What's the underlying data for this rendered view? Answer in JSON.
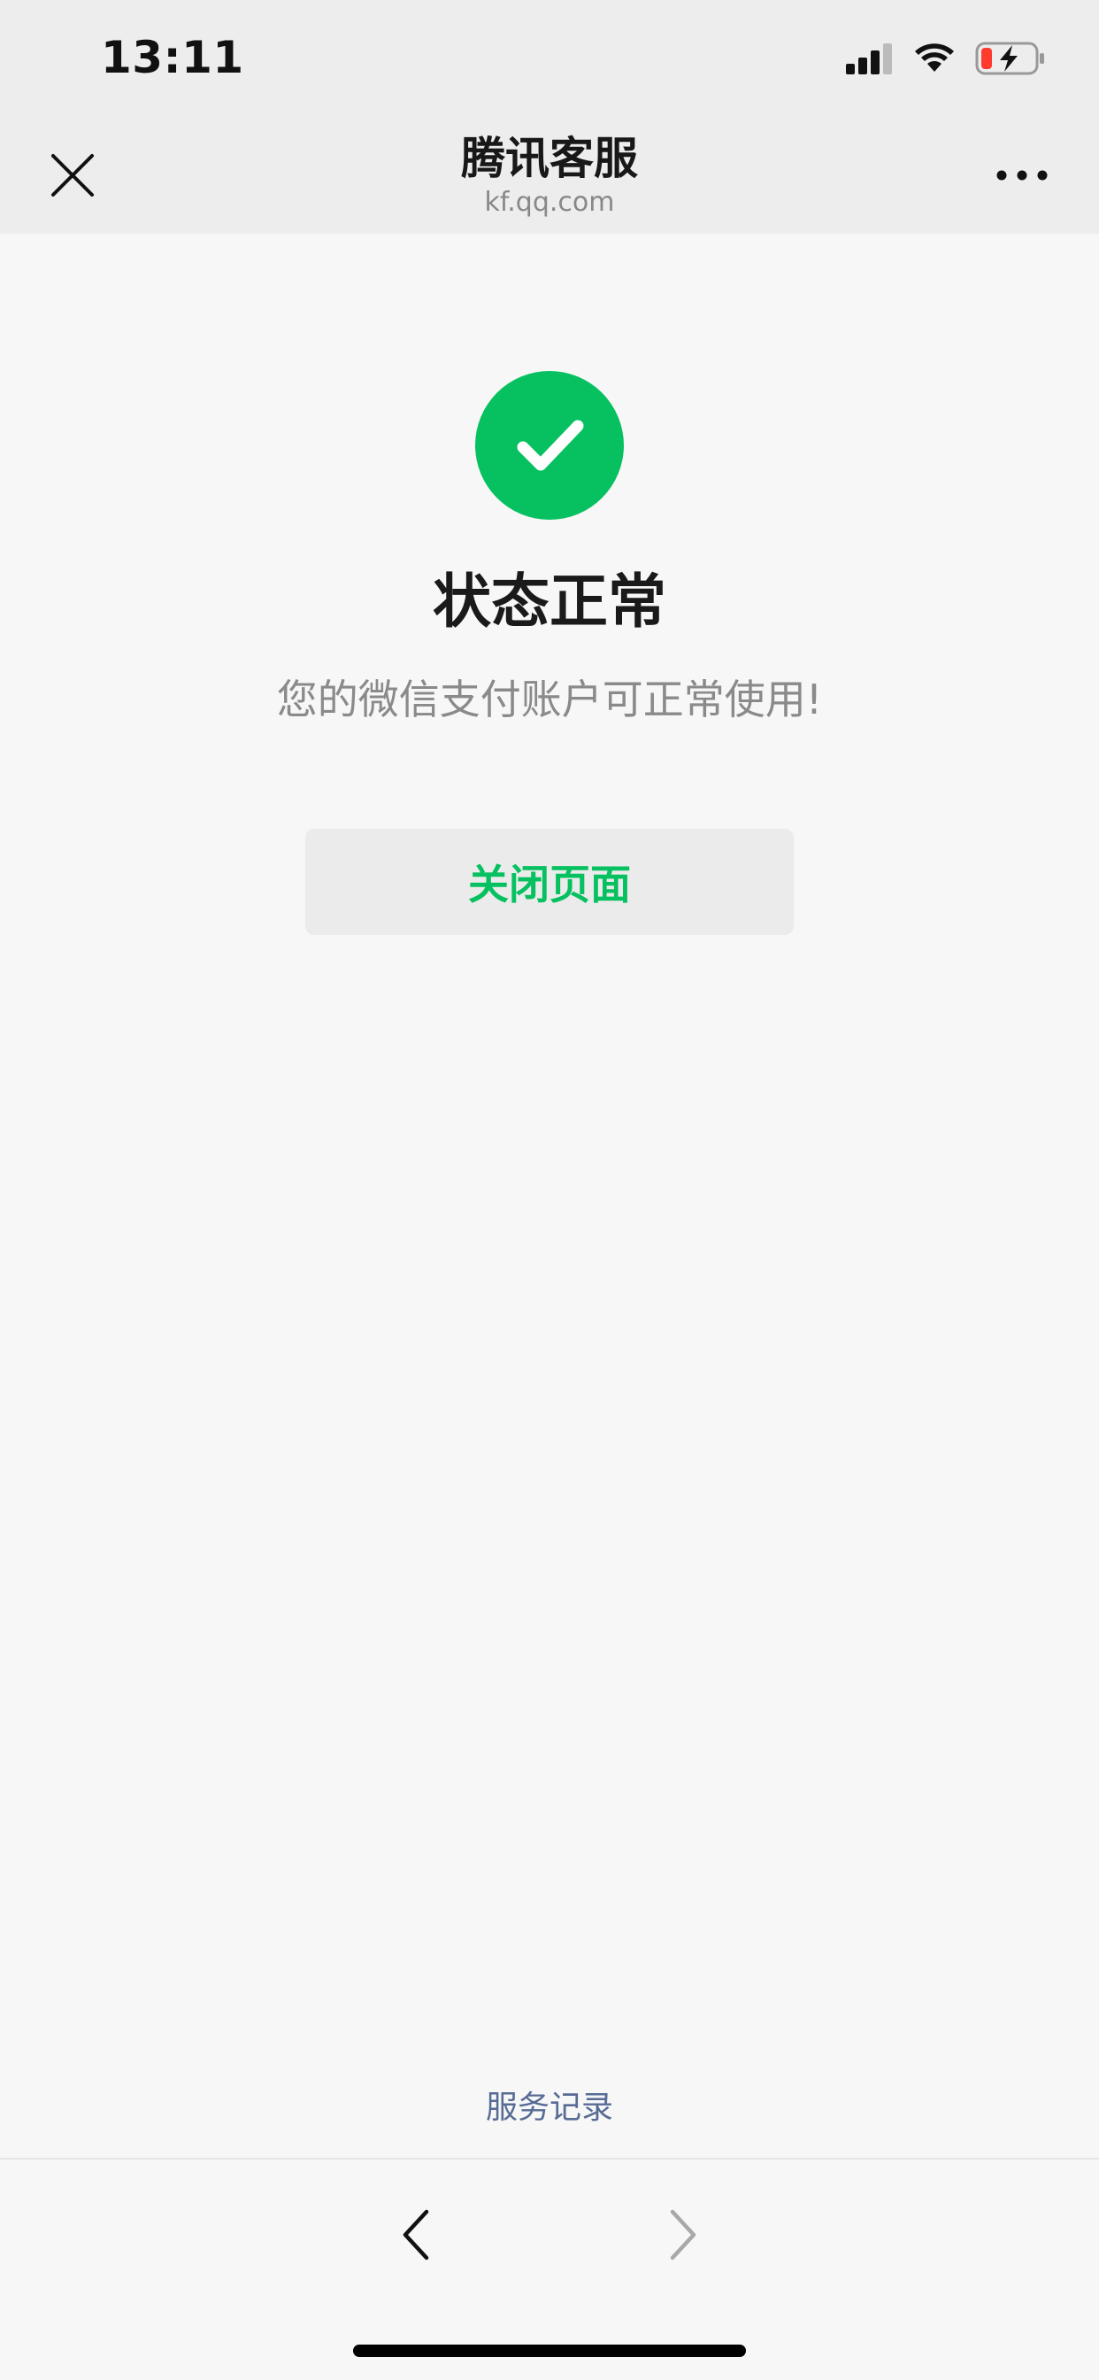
{
  "status_bar": {
    "time": "13:11",
    "signal_icon": "cellular-signal-icon",
    "wifi_icon": "wifi-icon",
    "battery_icon": "battery-charging-icon"
  },
  "nav": {
    "title": "腾讯客服",
    "subtitle": "kf.qq.com",
    "close_icon": "close-icon",
    "more_icon": "more-icon"
  },
  "result": {
    "icon": "success-check-icon",
    "title": "状态正常",
    "description": "您的微信支付账户可正常使用!",
    "close_button_label": "关闭页面"
  },
  "footer": {
    "service_records_label": "服务记录",
    "back_icon": "chevron-left-icon",
    "forward_icon": "chevron-right-icon"
  },
  "colors": {
    "accent": "#07c160",
    "link": "#576b95",
    "header_bg": "#ededed",
    "page_bg": "#f7f7f7"
  }
}
